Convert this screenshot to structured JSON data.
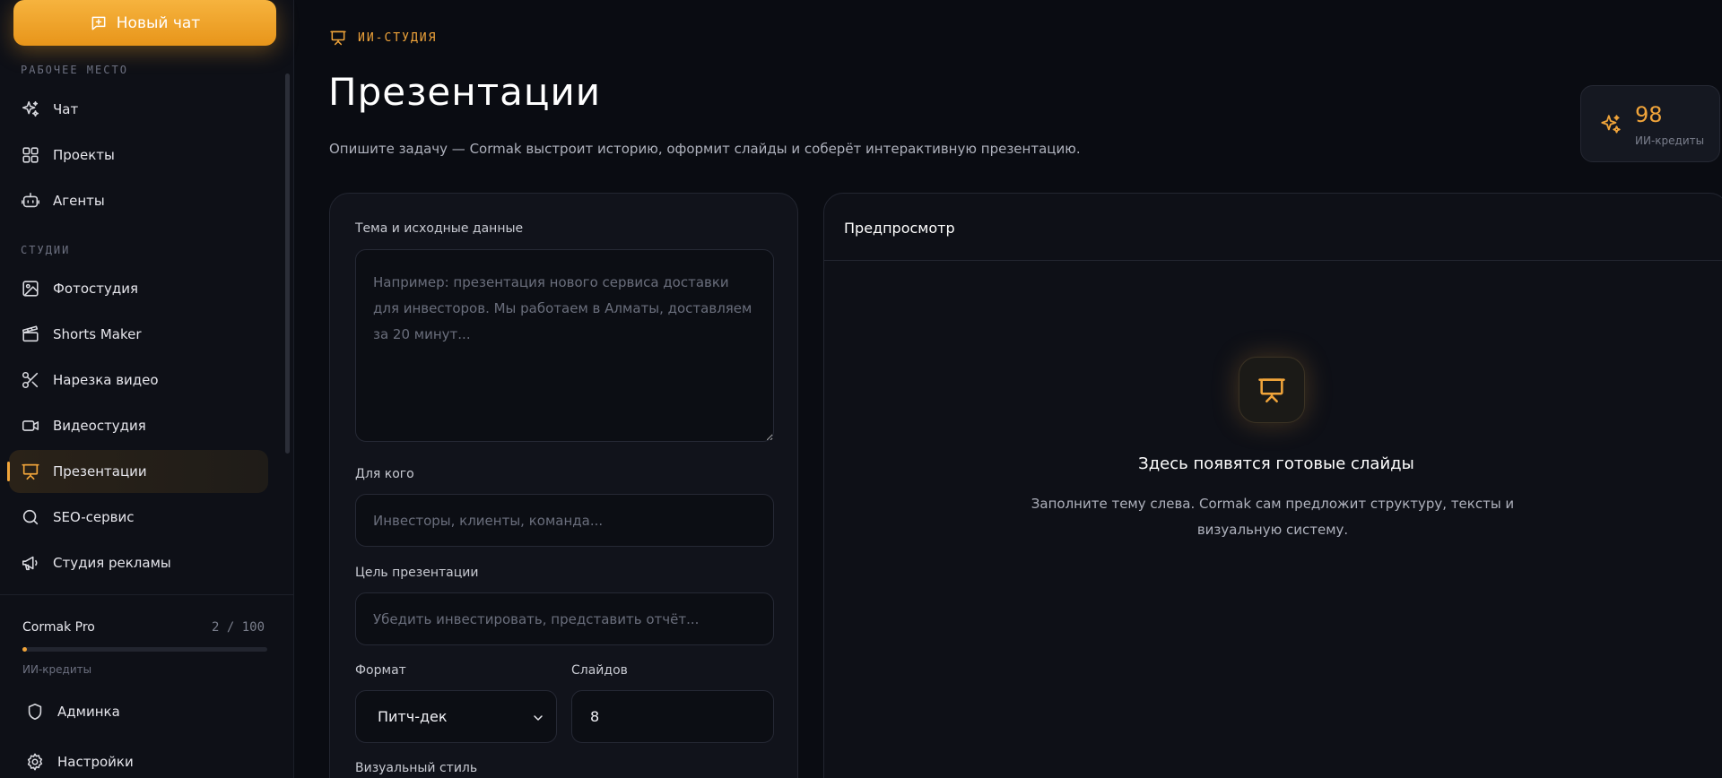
{
  "sidebar": {
    "new_chat": "Новый чат",
    "workspace_label": "РАБОЧЕЕ МЕСТО",
    "workspace_items": [
      {
        "label": "Чат",
        "icon": "sparkles-icon"
      },
      {
        "label": "Проекты",
        "icon": "grid-icon"
      },
      {
        "label": "Агенты",
        "icon": "robot-icon"
      }
    ],
    "studios_label": "СТУДИИ",
    "studio_items": [
      {
        "label": "Фотостудия",
        "icon": "image-icon"
      },
      {
        "label": "Shorts Maker",
        "icon": "clapperboard-icon"
      },
      {
        "label": "Нарезка видео",
        "icon": "scissors-icon"
      },
      {
        "label": "Видеостудия",
        "icon": "video-icon"
      },
      {
        "label": "Презентации",
        "icon": "presentation-icon",
        "active": true
      },
      {
        "label": "SEO-сервис",
        "icon": "search-icon"
      },
      {
        "label": "Студия рекламы",
        "icon": "megaphone-icon"
      }
    ],
    "plan": {
      "name": "Cormak Pro",
      "count": "2 / 100",
      "used_fraction": 0.02,
      "sub": "ИИ-кредиты"
    },
    "admin": "Админка",
    "settings": "Настройки"
  },
  "header": {
    "crumb": "ИИ-СТУДИЯ",
    "title": "Презентации",
    "description": "Опишите задачу — Cormak выстроит историю, оформит слайды и соберёт интерактивную презентацию."
  },
  "credits": {
    "value": "98",
    "label": "ИИ-кредиты"
  },
  "form": {
    "topic_label": "Тема и исходные данные",
    "topic_placeholder": "Например: презентация нового сервиса доставки для инвесторов. Мы работаем в Алматы, доставляем за 20 минут...",
    "audience_label": "Для кого",
    "audience_placeholder": "Инвесторы, клиенты, команда...",
    "goal_label": "Цель презентации",
    "goal_placeholder": "Убедить инвестировать, представить отчёт...",
    "format_label": "Формат",
    "format_value": "Питч-дек",
    "slides_label": "Слайдов",
    "slides_value": "8",
    "style_label": "Визуальный стиль"
  },
  "preview": {
    "title": "Предпросмотр",
    "empty_title": "Здесь появятся готовые слайды",
    "empty_text": "Заполните тему слева. Cormak сам предложит структуру, тексты и визуальную систему."
  },
  "colors": {
    "accent": "#f0a43a",
    "background": "#0a0c12"
  }
}
